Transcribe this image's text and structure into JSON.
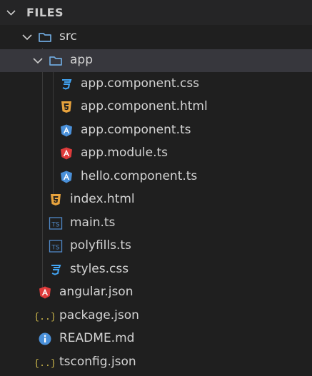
{
  "header": {
    "title": "FILES"
  },
  "tree": {
    "items": [
      {
        "label": "src",
        "icon": "folder-icon",
        "twisty": "chevron-down-icon"
      },
      {
        "label": "app",
        "icon": "folder-icon",
        "twisty": "chevron-down-icon",
        "selected": true
      },
      {
        "label": "app.component.css",
        "icon": "css-icon"
      },
      {
        "label": "app.component.html",
        "icon": "html5-icon"
      },
      {
        "label": "app.component.ts",
        "icon": "angular-component-icon"
      },
      {
        "label": "app.module.ts",
        "icon": "angular-icon"
      },
      {
        "label": "hello.component.ts",
        "icon": "angular-component-icon"
      },
      {
        "label": "index.html",
        "icon": "html5-icon"
      },
      {
        "label": "main.ts",
        "icon": "typescript-icon"
      },
      {
        "label": "polyfills.ts",
        "icon": "typescript-icon"
      },
      {
        "label": "styles.css",
        "icon": "css-icon"
      },
      {
        "label": "angular.json",
        "icon": "angular-icon"
      },
      {
        "label": "package.json",
        "icon": "json-icon"
      },
      {
        "label": "README.md",
        "icon": "info-icon"
      },
      {
        "label": "tsconfig.json",
        "icon": "json-icon"
      }
    ]
  },
  "colors": {
    "background": "#1e1e1e",
    "selected_row": "#37373d",
    "folder": "#6fa8dc",
    "css": "#42a5f5",
    "html": "#e8a33d",
    "angular_blue": "#4a90d9",
    "angular_red": "#dd3b3b",
    "typescript": "#4f88c6",
    "json": "#c9b44a",
    "info": "#4a90d9"
  }
}
